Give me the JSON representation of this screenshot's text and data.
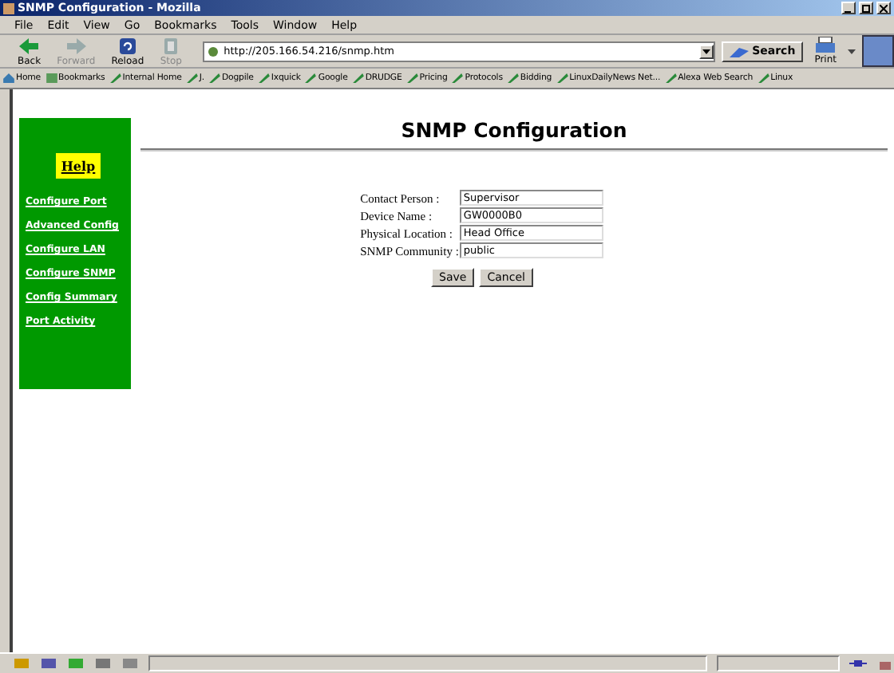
{
  "window": {
    "title": "SNMP Configuration - Mozilla"
  },
  "menu": [
    "File",
    "Edit",
    "View",
    "Go",
    "Bookmarks",
    "Tools",
    "Window",
    "Help"
  ],
  "toolbar": {
    "buttons": [
      {
        "label": "Back",
        "kind": "back",
        "disabled": false
      },
      {
        "label": "Forward",
        "kind": "forward",
        "disabled": true
      },
      {
        "label": "Reload",
        "kind": "reload",
        "disabled": false
      },
      {
        "label": "Stop",
        "kind": "stop",
        "disabled": true
      }
    ],
    "address": "http://205.166.54.216/snmp.htm",
    "search": "Search",
    "print": "Print"
  },
  "bookmarks": [
    {
      "label": "Home",
      "kind": "home"
    },
    {
      "label": "Bookmarks",
      "kind": "bookmarks"
    },
    {
      "label": "Internal Home",
      "kind": "link"
    },
    {
      "label": "J.",
      "kind": "link"
    },
    {
      "label": "Dogpile",
      "kind": "link"
    },
    {
      "label": "Ixquick",
      "kind": "link"
    },
    {
      "label": "Google",
      "kind": "link"
    },
    {
      "label": "DRUDGE",
      "kind": "link"
    },
    {
      "label": "Pricing",
      "kind": "link"
    },
    {
      "label": "Protocols",
      "kind": "link"
    },
    {
      "label": "Bidding",
      "kind": "link"
    },
    {
      "label": "LinuxDailyNews Net...",
      "kind": "link"
    },
    {
      "label": "Alexa Web Search",
      "kind": "link"
    },
    {
      "label": "Linux",
      "kind": "link"
    }
  ],
  "sidebar": {
    "help": "Help",
    "items": [
      "Configure Port",
      "Advanced Config",
      "Configure LAN",
      "Configure SNMP",
      "Config Summary",
      "Port Activity"
    ]
  },
  "page": {
    "heading": "SNMP Configuration",
    "fields": [
      {
        "label": "Contact Person :",
        "value": "Supervisor"
      },
      {
        "label": "Device Name :",
        "value": "GW0000B0"
      },
      {
        "label": "Physical Location :",
        "value": "Head Office"
      },
      {
        "label": "SNMP Community :",
        "value": "public"
      }
    ],
    "buttons": [
      "Save",
      "Cancel"
    ]
  }
}
